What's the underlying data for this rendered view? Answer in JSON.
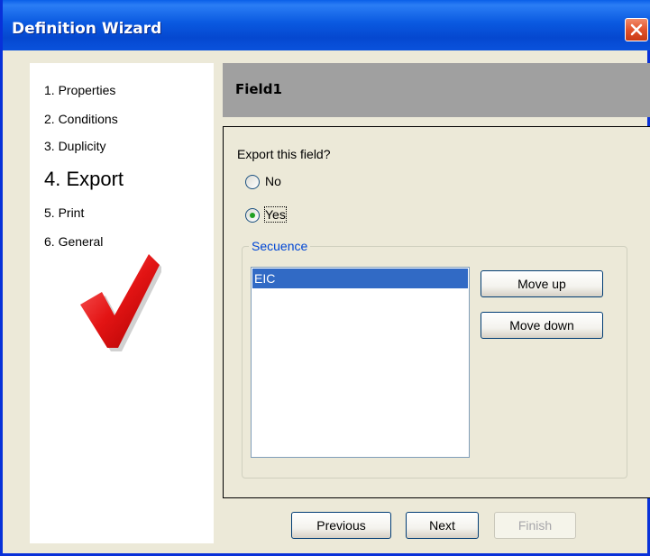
{
  "window": {
    "title": "Definition Wizard"
  },
  "steps": [
    {
      "label": "1. Properties",
      "active": false
    },
    {
      "label": "2. Conditions",
      "active": false
    },
    {
      "label": "3. Duplicity",
      "active": false
    },
    {
      "label": "4. Export",
      "active": true
    },
    {
      "label": "5. Print",
      "active": false
    },
    {
      "label": "6. General",
      "active": false
    }
  ],
  "field": {
    "name": "Field1"
  },
  "export": {
    "question": "Export this field?",
    "options": [
      {
        "label": "No",
        "selected": false
      },
      {
        "label": "Yes",
        "selected": true
      }
    ]
  },
  "sequence": {
    "legend": "Secuence",
    "items": [
      "EIC"
    ],
    "selected_index": 0,
    "move_up_label": "Move up",
    "move_down_label": "Move down"
  },
  "footer": {
    "previous_label": "Previous",
    "next_label": "Next",
    "finish_label": "Finish"
  },
  "colors": {
    "title_bar": "#0a59e0",
    "selection": "#316ac5",
    "checkmark": "#e01010",
    "legend_text": "#0046d5"
  }
}
